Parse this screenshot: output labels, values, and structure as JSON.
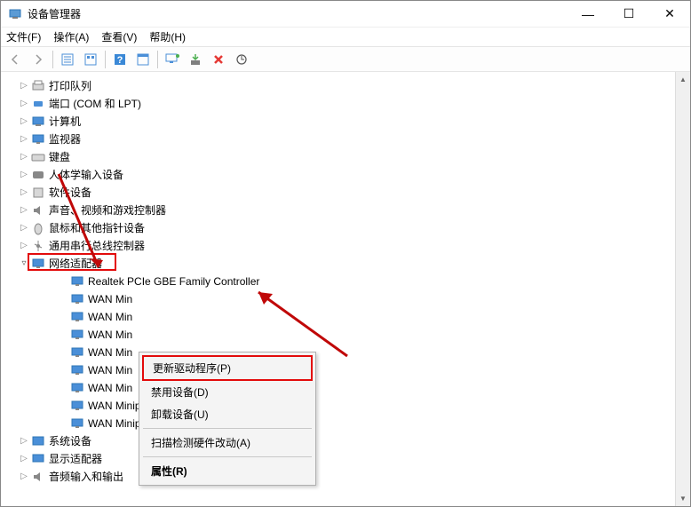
{
  "window": {
    "title": "设备管理器",
    "btn_min": "—",
    "btn_max": "☐",
    "btn_close": "✕"
  },
  "menu": {
    "file": "文件(F)",
    "action": "操作(A)",
    "view": "查看(V)",
    "help": "帮助(H)"
  },
  "toolbar": {
    "back": "←",
    "forward": "→",
    "up": "⿴",
    "detail": "▤",
    "help": "?",
    "refresh": "⟳",
    "monitor": "🖵",
    "install": "⬇",
    "remove": "✖",
    "scan": "⟳"
  },
  "tree": {
    "printQueues": "打印队列",
    "ports": "端口 (COM 和 LPT)",
    "computer": "计算机",
    "monitors": "监视器",
    "keyboards": "键盘",
    "hid": "人体学输入设备",
    "software": "软件设备",
    "sound": "声音、视频和游戏控制器",
    "mice": "鼠标和其他指针设备",
    "usb": "通用串行总线控制器",
    "network": "网络适配器",
    "networkChildren": [
      "Realtek PCIe GBE Family Controller",
      "WAN Min",
      "WAN Min",
      "WAN Min",
      "WAN Min",
      "WAN Min",
      "WAN Min",
      "WAN Miniport (PPTP)",
      "WAN Miniport (SSTP)"
    ],
    "system": "系统设备",
    "display": "显示适配器",
    "audio": "音频输入和输出"
  },
  "contextMenu": {
    "updateDriver": "更新驱动程序(P)",
    "disable": "禁用设备(D)",
    "uninstall": "卸载设备(U)",
    "scanHw": "扫描检测硬件改动(A)",
    "properties": "属性(R)"
  }
}
